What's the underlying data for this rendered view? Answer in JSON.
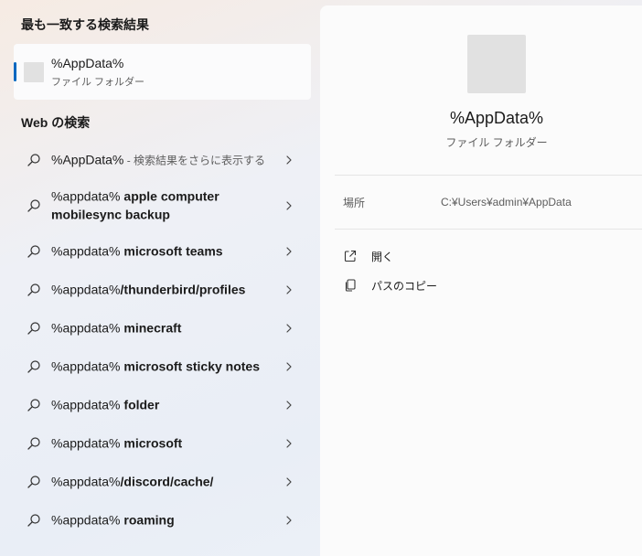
{
  "best_match": {
    "heading": "最も一致する検索結果",
    "name": "%AppData%",
    "type": "ファイル フォルダー"
  },
  "web": {
    "heading": "Web の検索",
    "items": [
      {
        "query": "%AppData%",
        "suggestion": "",
        "hint": " - 検索結果をさらに表示する"
      },
      {
        "query": "%appdata% ",
        "suggestion": "apple computer mobilesync backup",
        "hint": ""
      },
      {
        "query": "%appdata% ",
        "suggestion": "microsoft teams",
        "hint": ""
      },
      {
        "query": "%appdata%",
        "suggestion": "/thunderbird/profiles",
        "hint": ""
      },
      {
        "query": "%appdata% ",
        "suggestion": "minecraft",
        "hint": ""
      },
      {
        "query": "%appdata% ",
        "suggestion": "microsoft sticky notes",
        "hint": ""
      },
      {
        "query": "%appdata% ",
        "suggestion": "folder",
        "hint": ""
      },
      {
        "query": "%appdata% ",
        "suggestion": "microsoft",
        "hint": ""
      },
      {
        "query": "%appdata%",
        "suggestion": "/discord/cache/",
        "hint": ""
      },
      {
        "query": "%appdata% ",
        "suggestion": "roaming",
        "hint": ""
      }
    ]
  },
  "preview": {
    "name": "%AppData%",
    "type": "ファイル フォルダー",
    "location_label": "場所",
    "location_value": "C:¥Users¥admin¥AppData",
    "actions": [
      {
        "label": "開く",
        "icon": "open-external-icon"
      },
      {
        "label": "パスのコピー",
        "icon": "copy-icon"
      }
    ]
  },
  "colors": {
    "accent": "#0067c0"
  }
}
